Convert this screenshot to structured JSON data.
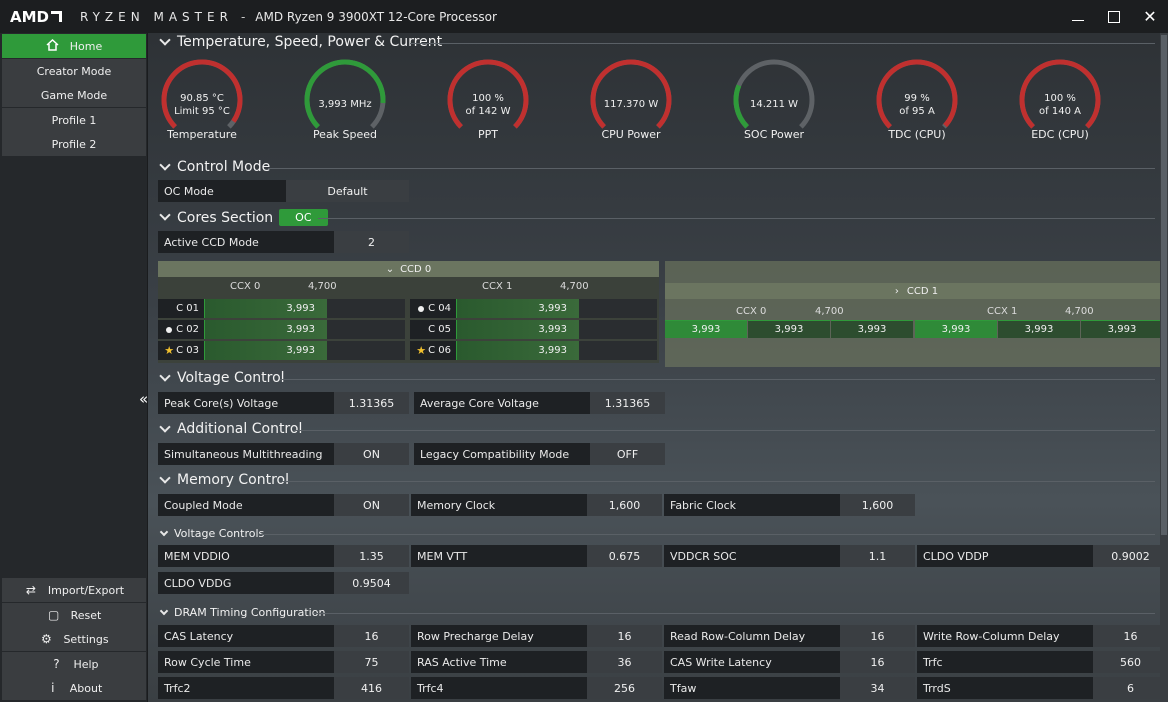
{
  "titlebar": {
    "brand": "AMD",
    "product": "RYZEN MASTER",
    "separator": "-",
    "processor": "AMD Ryzen 9 3900XT 12-Core Processor",
    "minimize_icon": "minimize-icon",
    "maximize_icon": "maximize-icon",
    "close_symbol": "✕"
  },
  "sidebar": {
    "top_items": [
      {
        "label": "Home",
        "icon": "home-icon",
        "active": true
      },
      {
        "label": "Creator Mode"
      },
      {
        "label": "Game Mode"
      },
      {
        "label": "Profile 1"
      },
      {
        "label": "Profile 2"
      }
    ],
    "bottom_items": [
      {
        "label": "Import/Export",
        "icon": "import-export-icon",
        "glyph": "⇄"
      },
      {
        "label": "Reset",
        "icon": "reset-icon",
        "glyph": "▢"
      },
      {
        "label": "Settings",
        "icon": "gear-icon",
        "glyph": "⚙"
      },
      {
        "label": "Help",
        "icon": "help-icon",
        "glyph": "?"
      },
      {
        "label": "About",
        "icon": "info-icon",
        "glyph": "i"
      }
    ],
    "collapse_glyph": "«"
  },
  "sections": {
    "temperature": "Temperature, Speed, Power & Current",
    "control_mode": "Control Mode",
    "cores": "Cores Section",
    "voltage_control": "Voltage Control",
    "additional_control": "Additional Control",
    "memory_control": "Memory Control",
    "voltage_controls": "Voltage Controls",
    "dram_timing": "DRAM Timing Configuration"
  },
  "gauges": [
    {
      "line1": "90.85 °C",
      "line2": "Limit 95 °C",
      "label": "Temperature",
      "level": 0.96,
      "color": "#c0302f"
    },
    {
      "line1": "3,993  MHz",
      "line2": "",
      "label": "Peak Speed",
      "level": 0.85,
      "color": "#2f9a3a"
    },
    {
      "line1": "100 %",
      "line2": "of 142 W",
      "label": "PPT",
      "level": 1.0,
      "color": "#c0302f"
    },
    {
      "line1": "117.370 W",
      "line2": "",
      "label": "CPU Power",
      "level": 1.0,
      "color": "#c0302f"
    },
    {
      "line1": "14.211 W",
      "line2": "",
      "label": "SOC Power",
      "level": 0.25,
      "color": "#2f9a3a"
    },
    {
      "line1": "99 %",
      "line2": "of 95 A",
      "label": "TDC (CPU)",
      "level": 0.99,
      "color": "#c0302f"
    },
    {
      "line1": "100 %",
      "line2": "of 140 A",
      "label": "EDC (CPU)",
      "level": 1.0,
      "color": "#c0302f"
    }
  ],
  "control_mode": {
    "label": "OC Mode",
    "value": "Default"
  },
  "cores": {
    "badge": "OC",
    "active_ccd_label": "Active CCD Mode",
    "active_ccd_value": "2",
    "ccd0": {
      "title": "CCD 0",
      "ccx0": {
        "label": "CCX 0",
        "freq": "4,700"
      },
      "ccx1": {
        "label": "CCX 1",
        "freq": "4,700"
      },
      "left_cores": [
        {
          "name": "C 01",
          "value": "3,993",
          "marker": ""
        },
        {
          "name": "C 02",
          "value": "3,993",
          "marker": "dot"
        },
        {
          "name": "C 03",
          "value": "3,993",
          "marker": "star"
        }
      ],
      "right_cores": [
        {
          "name": "C 04",
          "value": "3,993",
          "marker": "dot"
        },
        {
          "name": "C 05",
          "value": "3,993",
          "marker": ""
        },
        {
          "name": "C 06",
          "value": "3,993",
          "marker": "star"
        }
      ]
    },
    "ccd1": {
      "title": "CCD 1",
      "ccx0": {
        "label": "CCX 0",
        "freq": "4,700"
      },
      "ccx1": {
        "label": "CCX 1",
        "freq": "4,700"
      },
      "values": [
        "3,993",
        "3,993",
        "3,993",
        "3,993",
        "3,993",
        "3,993"
      ]
    }
  },
  "voltage": {
    "peak_label": "Peak Core(s) Voltage",
    "peak_value": "1.31365",
    "avg_label": "Average Core Voltage",
    "avg_value": "1.31365"
  },
  "additional": {
    "smt_label": "Simultaneous Multithreading",
    "smt_value": "ON",
    "legacy_label": "Legacy Compatibility Mode",
    "legacy_value": "OFF"
  },
  "memory": {
    "coupled_label": "Coupled Mode",
    "coupled_value": "ON",
    "mem_clock_label": "Memory Clock",
    "mem_clock_value": "1,600",
    "fabric_label": "Fabric Clock",
    "fabric_value": "1,600"
  },
  "voltage_controls": [
    {
      "label": "MEM VDDIO",
      "value": "1.35"
    },
    {
      "label": "MEM VTT",
      "value": "0.675"
    },
    {
      "label": "VDDCR SOC",
      "value": "1.1"
    },
    {
      "label": "CLDO VDDP",
      "value": "0.9002"
    },
    {
      "label": "CLDO VDDG",
      "value": "0.9504"
    }
  ],
  "dram_timing": [
    [
      {
        "label": "CAS Latency",
        "value": "16"
      },
      {
        "label": "Row Precharge Delay",
        "value": "16"
      },
      {
        "label": "Read Row-Column Delay",
        "value": "16"
      },
      {
        "label": "Write Row-Column Delay",
        "value": "16"
      }
    ],
    [
      {
        "label": "Row Cycle Time",
        "value": "75"
      },
      {
        "label": "RAS Active Time",
        "value": "36"
      },
      {
        "label": "CAS Write Latency",
        "value": "16"
      },
      {
        "label": "Trfc",
        "value": "560"
      }
    ],
    [
      {
        "label": "Trfc2",
        "value": "416"
      },
      {
        "label": "Trfc4",
        "value": "256"
      },
      {
        "label": "Tfaw",
        "value": "34"
      },
      {
        "label": "TrrdS",
        "value": "6"
      }
    ]
  ]
}
